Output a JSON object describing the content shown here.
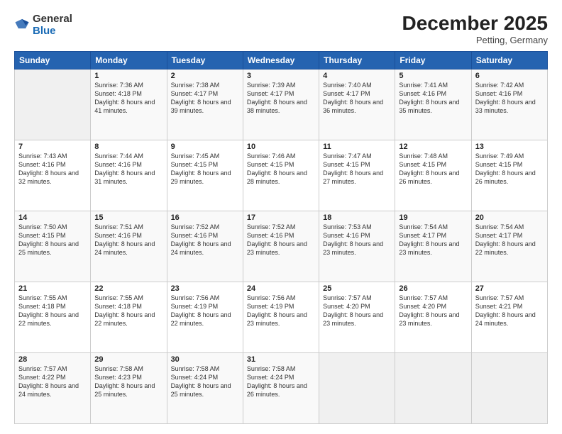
{
  "logo": {
    "general": "General",
    "blue": "Blue"
  },
  "header": {
    "month_year": "December 2025",
    "location": "Petting, Germany"
  },
  "weekdays": [
    "Sunday",
    "Monday",
    "Tuesday",
    "Wednesday",
    "Thursday",
    "Friday",
    "Saturday"
  ],
  "weeks": [
    [
      {
        "day": "",
        "sunrise": "",
        "sunset": "",
        "daylight": ""
      },
      {
        "day": "1",
        "sunrise": "Sunrise: 7:36 AM",
        "sunset": "Sunset: 4:18 PM",
        "daylight": "Daylight: 8 hours and 41 minutes."
      },
      {
        "day": "2",
        "sunrise": "Sunrise: 7:38 AM",
        "sunset": "Sunset: 4:17 PM",
        "daylight": "Daylight: 8 hours and 39 minutes."
      },
      {
        "day": "3",
        "sunrise": "Sunrise: 7:39 AM",
        "sunset": "Sunset: 4:17 PM",
        "daylight": "Daylight: 8 hours and 38 minutes."
      },
      {
        "day": "4",
        "sunrise": "Sunrise: 7:40 AM",
        "sunset": "Sunset: 4:17 PM",
        "daylight": "Daylight: 8 hours and 36 minutes."
      },
      {
        "day": "5",
        "sunrise": "Sunrise: 7:41 AM",
        "sunset": "Sunset: 4:16 PM",
        "daylight": "Daylight: 8 hours and 35 minutes."
      },
      {
        "day": "6",
        "sunrise": "Sunrise: 7:42 AM",
        "sunset": "Sunset: 4:16 PM",
        "daylight": "Daylight: 8 hours and 33 minutes."
      }
    ],
    [
      {
        "day": "7",
        "sunrise": "Sunrise: 7:43 AM",
        "sunset": "Sunset: 4:16 PM",
        "daylight": "Daylight: 8 hours and 32 minutes."
      },
      {
        "day": "8",
        "sunrise": "Sunrise: 7:44 AM",
        "sunset": "Sunset: 4:16 PM",
        "daylight": "Daylight: 8 hours and 31 minutes."
      },
      {
        "day": "9",
        "sunrise": "Sunrise: 7:45 AM",
        "sunset": "Sunset: 4:15 PM",
        "daylight": "Daylight: 8 hours and 29 minutes."
      },
      {
        "day": "10",
        "sunrise": "Sunrise: 7:46 AM",
        "sunset": "Sunset: 4:15 PM",
        "daylight": "Daylight: 8 hours and 28 minutes."
      },
      {
        "day": "11",
        "sunrise": "Sunrise: 7:47 AM",
        "sunset": "Sunset: 4:15 PM",
        "daylight": "Daylight: 8 hours and 27 minutes."
      },
      {
        "day": "12",
        "sunrise": "Sunrise: 7:48 AM",
        "sunset": "Sunset: 4:15 PM",
        "daylight": "Daylight: 8 hours and 26 minutes."
      },
      {
        "day": "13",
        "sunrise": "Sunrise: 7:49 AM",
        "sunset": "Sunset: 4:15 PM",
        "daylight": "Daylight: 8 hours and 26 minutes."
      }
    ],
    [
      {
        "day": "14",
        "sunrise": "Sunrise: 7:50 AM",
        "sunset": "Sunset: 4:15 PM",
        "daylight": "Daylight: 8 hours and 25 minutes."
      },
      {
        "day": "15",
        "sunrise": "Sunrise: 7:51 AM",
        "sunset": "Sunset: 4:16 PM",
        "daylight": "Daylight: 8 hours and 24 minutes."
      },
      {
        "day": "16",
        "sunrise": "Sunrise: 7:52 AM",
        "sunset": "Sunset: 4:16 PM",
        "daylight": "Daylight: 8 hours and 24 minutes."
      },
      {
        "day": "17",
        "sunrise": "Sunrise: 7:52 AM",
        "sunset": "Sunset: 4:16 PM",
        "daylight": "Daylight: 8 hours and 23 minutes."
      },
      {
        "day": "18",
        "sunrise": "Sunrise: 7:53 AM",
        "sunset": "Sunset: 4:16 PM",
        "daylight": "Daylight: 8 hours and 23 minutes."
      },
      {
        "day": "19",
        "sunrise": "Sunrise: 7:54 AM",
        "sunset": "Sunset: 4:17 PM",
        "daylight": "Daylight: 8 hours and 23 minutes."
      },
      {
        "day": "20",
        "sunrise": "Sunrise: 7:54 AM",
        "sunset": "Sunset: 4:17 PM",
        "daylight": "Daylight: 8 hours and 22 minutes."
      }
    ],
    [
      {
        "day": "21",
        "sunrise": "Sunrise: 7:55 AM",
        "sunset": "Sunset: 4:18 PM",
        "daylight": "Daylight: 8 hours and 22 minutes."
      },
      {
        "day": "22",
        "sunrise": "Sunrise: 7:55 AM",
        "sunset": "Sunset: 4:18 PM",
        "daylight": "Daylight: 8 hours and 22 minutes."
      },
      {
        "day": "23",
        "sunrise": "Sunrise: 7:56 AM",
        "sunset": "Sunset: 4:19 PM",
        "daylight": "Daylight: 8 hours and 22 minutes."
      },
      {
        "day": "24",
        "sunrise": "Sunrise: 7:56 AM",
        "sunset": "Sunset: 4:19 PM",
        "daylight": "Daylight: 8 hours and 23 minutes."
      },
      {
        "day": "25",
        "sunrise": "Sunrise: 7:57 AM",
        "sunset": "Sunset: 4:20 PM",
        "daylight": "Daylight: 8 hours and 23 minutes."
      },
      {
        "day": "26",
        "sunrise": "Sunrise: 7:57 AM",
        "sunset": "Sunset: 4:20 PM",
        "daylight": "Daylight: 8 hours and 23 minutes."
      },
      {
        "day": "27",
        "sunrise": "Sunrise: 7:57 AM",
        "sunset": "Sunset: 4:21 PM",
        "daylight": "Daylight: 8 hours and 24 minutes."
      }
    ],
    [
      {
        "day": "28",
        "sunrise": "Sunrise: 7:57 AM",
        "sunset": "Sunset: 4:22 PM",
        "daylight": "Daylight: 8 hours and 24 minutes."
      },
      {
        "day": "29",
        "sunrise": "Sunrise: 7:58 AM",
        "sunset": "Sunset: 4:23 PM",
        "daylight": "Daylight: 8 hours and 25 minutes."
      },
      {
        "day": "30",
        "sunrise": "Sunrise: 7:58 AM",
        "sunset": "Sunset: 4:24 PM",
        "daylight": "Daylight: 8 hours and 25 minutes."
      },
      {
        "day": "31",
        "sunrise": "Sunrise: 7:58 AM",
        "sunset": "Sunset: 4:24 PM",
        "daylight": "Daylight: 8 hours and 26 minutes."
      },
      {
        "day": "",
        "sunrise": "",
        "sunset": "",
        "daylight": ""
      },
      {
        "day": "",
        "sunrise": "",
        "sunset": "",
        "daylight": ""
      },
      {
        "day": "",
        "sunrise": "",
        "sunset": "",
        "daylight": ""
      }
    ]
  ]
}
